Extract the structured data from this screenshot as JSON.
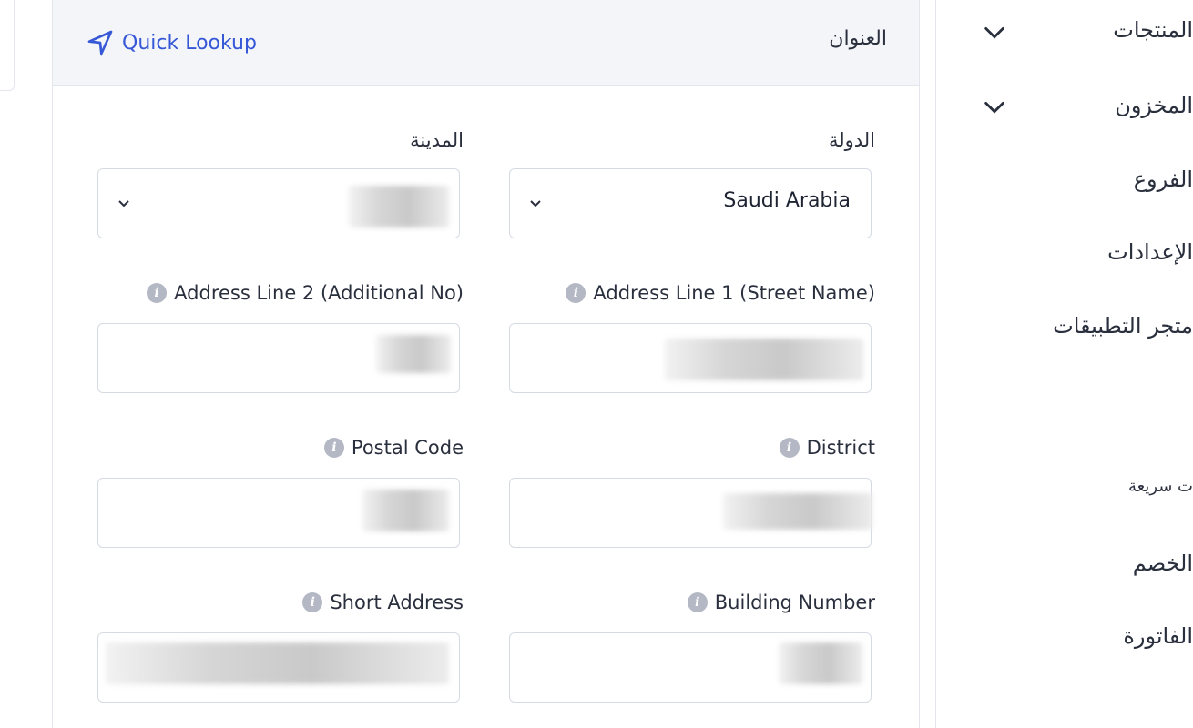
{
  "address_panel": {
    "title": "العنوان",
    "quick_lookup_label": "Quick Lookup",
    "fields": {
      "country": {
        "label": "الدولة",
        "value": "Saudi Arabia"
      },
      "city": {
        "label": "المدينة",
        "value": ""
      },
      "address_line_1": {
        "label": "Address Line 1 (Street Name)",
        "value": ""
      },
      "address_line_2": {
        "label": "Address Line 2 (Additional No)",
        "value": ""
      },
      "district": {
        "label": "District",
        "value": ""
      },
      "postal_code": {
        "label": "Postal Code",
        "value": ""
      },
      "building_number": {
        "label": "Building Number",
        "value": ""
      },
      "short_address": {
        "label": "Short Address",
        "value": ""
      }
    }
  },
  "sidebar": {
    "items": [
      {
        "label": "المنتجات",
        "has_chevron": true
      },
      {
        "label": "المخزون",
        "has_chevron": true
      },
      {
        "label": "الفروع"
      },
      {
        "label": "الإعدادات"
      },
      {
        "label": "متجر التطبيقات"
      },
      {
        "label": "ت سريعة"
      },
      {
        "label": "الخصم"
      },
      {
        "label": "الفاتورة"
      }
    ]
  },
  "icons": {
    "quick_lookup": "navigation-arrow-icon",
    "info": "info-icon",
    "select_chevron": "chevron-down-icon"
  },
  "colors": {
    "accent": "#3657d6",
    "header_bg": "#f3f5f9",
    "border": "#d6dae2",
    "info_icon": "#b3b8c4"
  }
}
